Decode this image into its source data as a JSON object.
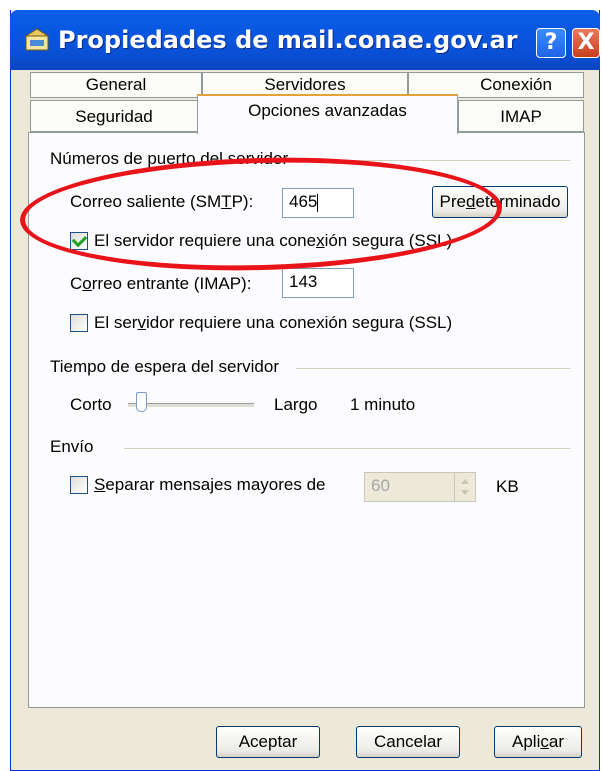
{
  "window": {
    "title": "Propiedades de mail.conae.gov.ar",
    "help_button": "?",
    "close_button": "X"
  },
  "tabs_row1": [
    "General",
    "Servidores",
    "Conexión"
  ],
  "tabs_row2": [
    "Seguridad",
    "Opciones avanzadas",
    "IMAP"
  ],
  "active_tab": "Opciones avanzadas",
  "ports": {
    "group_label": "Números de puerto del servidor",
    "smtp_label_pre": "Correo saliente (SM",
    "smtp_label_u": "T",
    "smtp_label_post": "P):",
    "smtp_value": "465",
    "default_button_pre": "Pre",
    "default_button_u": "d",
    "default_button_post": "eterminado",
    "smtp_ssl_pre": "El servidor requiere una cone",
    "smtp_ssl_u": "x",
    "smtp_ssl_post": "ión segura (SSL)",
    "smtp_ssl_checked": true,
    "imap_label_pre": "C",
    "imap_label_u": "o",
    "imap_label_post": "rreo entrante (IMAP):",
    "imap_value": "143",
    "imap_ssl_pre": "El ser",
    "imap_ssl_u": "v",
    "imap_ssl_post": "idor requiere una conexión segura (SSL)",
    "imap_ssl_checked": false
  },
  "timeout": {
    "group_label": "Tiempo de espera del servidor",
    "short_label": "Corto",
    "long_label": "Largo",
    "value_text": "1 minuto",
    "slider_fraction": 0.1
  },
  "sending": {
    "group_label": "Envío",
    "split_label_u": "S",
    "split_label_post": "eparar mensajes mayores de",
    "split_checked": false,
    "split_value": "60",
    "split_unit": "KB"
  },
  "buttons": {
    "accept": "Aceptar",
    "cancel": "Cancelar",
    "apply_pre": "Apli",
    "apply_u": "c",
    "apply_post": "ar"
  },
  "colors": {
    "title_bar": "#0a5ee8",
    "active_tab_accent": "#e2a23a",
    "annotation_ellipse": "#e8141a",
    "check_green": "#21a121"
  },
  "icons": {
    "title_icon": "mail-server-icon",
    "help": "help-icon",
    "close": "close-icon"
  }
}
